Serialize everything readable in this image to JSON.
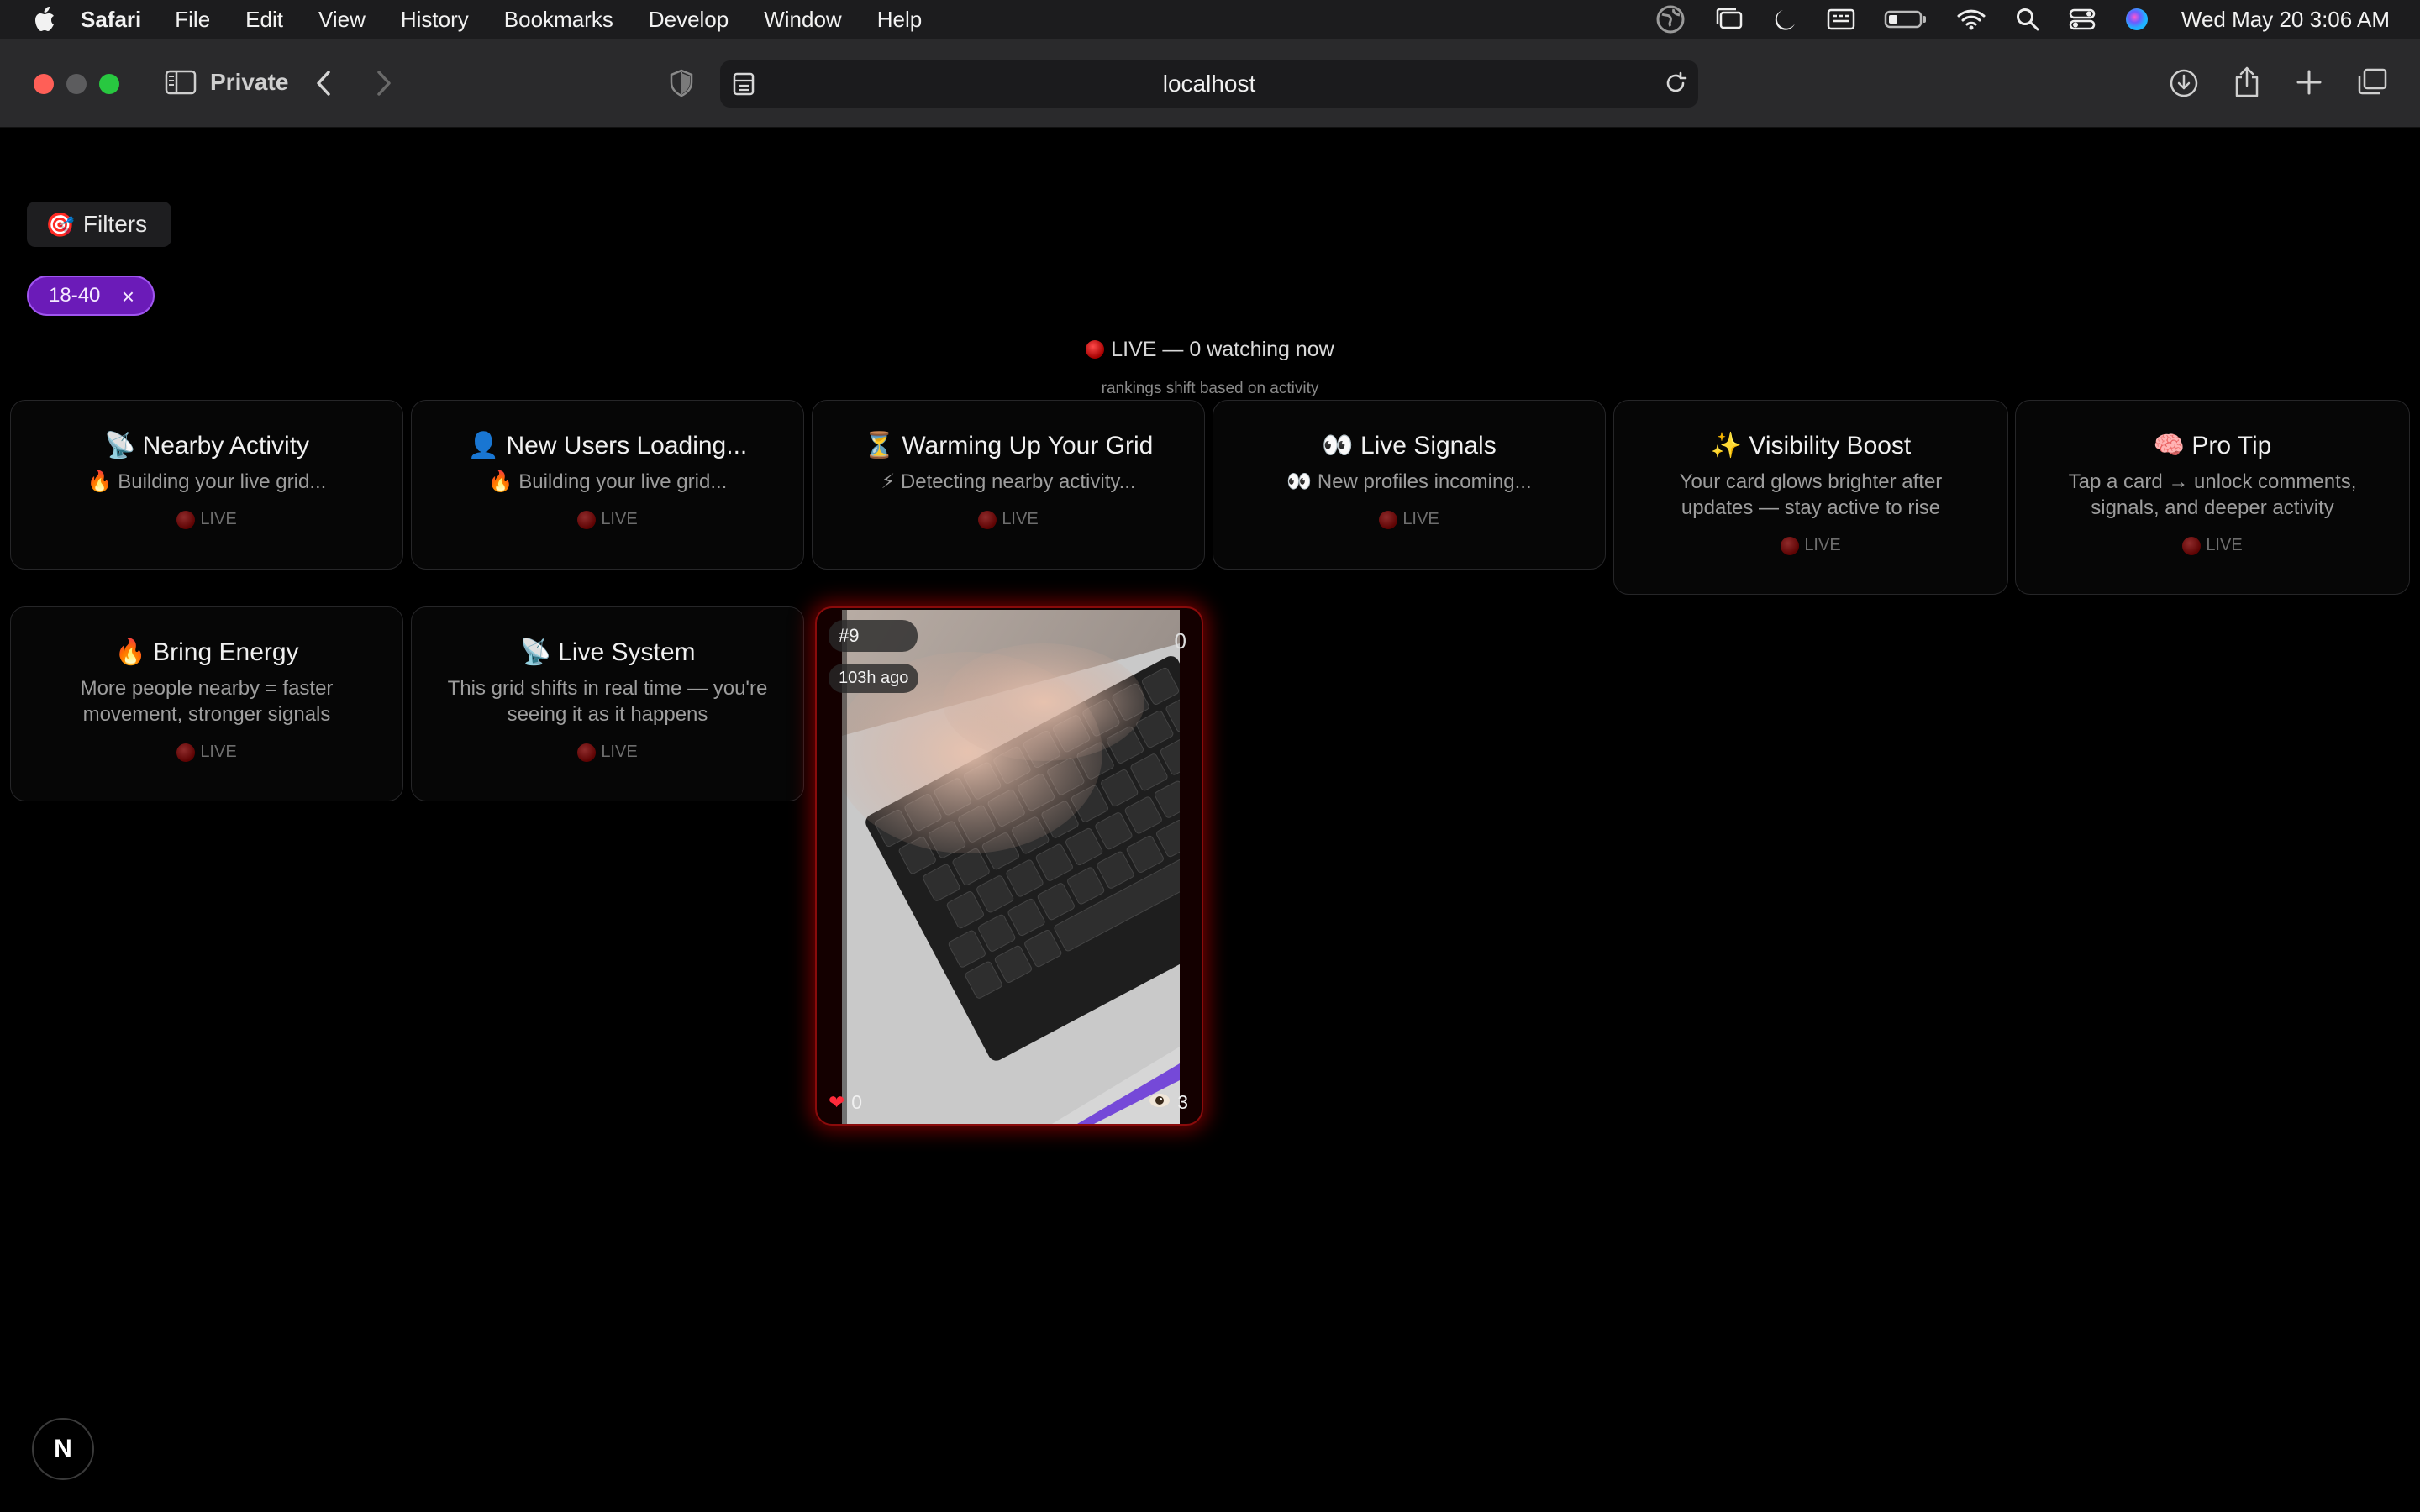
{
  "menubar": {
    "app_name": "Safari",
    "items": [
      "File",
      "Edit",
      "View",
      "History",
      "Bookmarks",
      "Develop",
      "Window",
      "Help"
    ],
    "clock": "Wed May 20  3:06 AM"
  },
  "toolbar": {
    "private_label": "Private",
    "url": "localhost"
  },
  "filters": {
    "button_label": "Filters",
    "button_emoji": "🎯",
    "chip_label": "18-40",
    "chip_close": "×"
  },
  "live": {
    "header": "LIVE — 0 watching now",
    "subtitle": "rankings shift based on activity",
    "badge_label": "LIVE"
  },
  "cards": [
    {
      "title": "📡 Nearby Activity",
      "desc": "🔥 Building your live grid..."
    },
    {
      "title": "👤 New Users Loading...",
      "desc": "🔥 Building your live grid..."
    },
    {
      "title": "⏳ Warming Up Your Grid",
      "desc": "⚡ Detecting nearby activity..."
    },
    {
      "title": "👀 Live Signals",
      "desc": "👀 New profiles incoming..."
    },
    {
      "title": "✨ Visibility Boost",
      "desc": "Your card glows brighter after updates — stay active to rise"
    },
    {
      "title": "🧠 Pro Tip",
      "desc": "Tap a card → unlock comments, signals, and deeper activity"
    },
    {
      "title": "🔥 Bring Energy",
      "desc": "More people nearby = faster movement, stronger signals"
    },
    {
      "title": "📡 Live System",
      "desc": "This grid shifts in real time — you're seeing it as it happens"
    }
  ],
  "video_card": {
    "rank": "#9",
    "age": "103h ago",
    "likes": "0",
    "views": "3",
    "corner_count": "0"
  },
  "next_badge": "N"
}
